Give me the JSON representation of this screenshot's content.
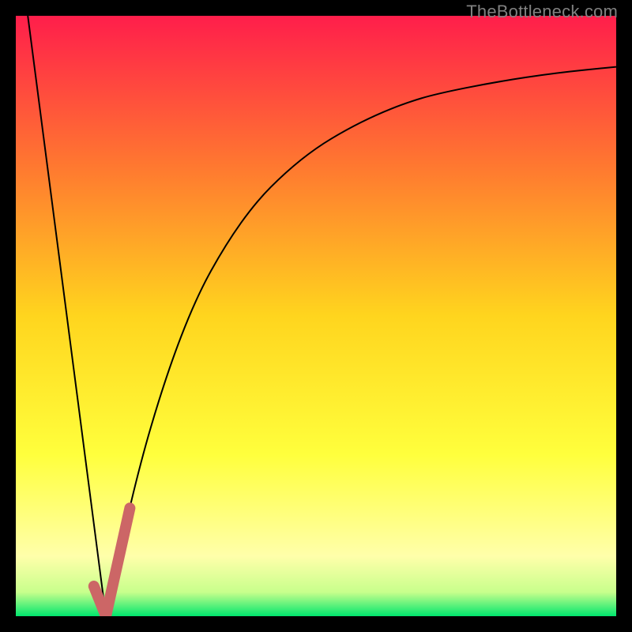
{
  "watermark": "TheBottleneck.com",
  "chart_data": {
    "type": "line",
    "title": "",
    "xlabel": "",
    "ylabel": "",
    "xlim": [
      0,
      100
    ],
    "ylim": [
      0,
      100
    ],
    "grid": false,
    "series": [
      {
        "name": "left-descent",
        "color": "#000000",
        "x": [
          2,
          15
        ],
        "values": [
          100,
          0
        ]
      },
      {
        "name": "right-curve",
        "color": "#000000",
        "x": [
          15,
          20,
          25,
          30,
          35,
          40,
          45,
          50,
          55,
          60,
          65,
          70,
          80,
          90,
          100
        ],
        "values": [
          0,
          23,
          40,
          53,
          62,
          69,
          74,
          78,
          81,
          83.5,
          85.5,
          87,
          89,
          90.5,
          91.5
        ]
      },
      {
        "name": "highlight",
        "color": "#CC6666",
        "x": [
          13,
          15,
          19
        ],
        "values": [
          5,
          0,
          18
        ]
      }
    ],
    "gradient_bands": [
      {
        "y": 100,
        "color": "#FF1E4B"
      },
      {
        "y": 75,
        "color": "#FF7830"
      },
      {
        "y": 50,
        "color": "#FFD51E"
      },
      {
        "y": 27,
        "color": "#FFFF3C"
      },
      {
        "y": 10,
        "color": "#FFFFAA"
      },
      {
        "y": 4,
        "color": "#C8FF8C"
      },
      {
        "y": 0,
        "color": "#00E66E"
      }
    ]
  }
}
